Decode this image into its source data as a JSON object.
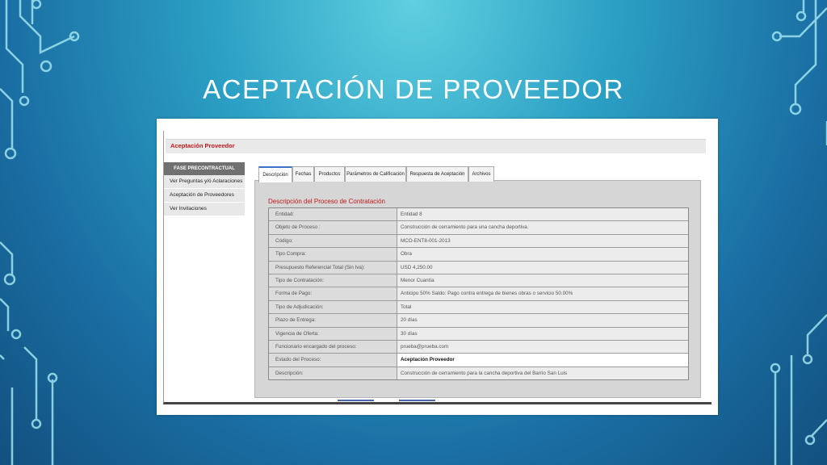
{
  "slide": {
    "title": "ACEPTACIÓN DE PROVEEDOR"
  },
  "app": {
    "header": "Aceptación Proveedor"
  },
  "sidebar": {
    "heading": "FASE PRECONTRACTUAL",
    "items": [
      {
        "label": "Ver Preguntas y/ó Aclaraciones"
      },
      {
        "label": "Aceptación de Proveedores"
      },
      {
        "label": "Ver Invitaciones"
      }
    ]
  },
  "tabs": [
    {
      "label": "Descripción"
    },
    {
      "label": "Fechas"
    },
    {
      "label": "Productos"
    },
    {
      "label": "Parámetros de Calificación"
    },
    {
      "label": "Respuesta de Aceptación"
    },
    {
      "label": "Archivos"
    }
  ],
  "section": {
    "title": "Descripción del Proceso de Contratación"
  },
  "details": [
    {
      "label": "Entidad:",
      "value": "Entidad 8"
    },
    {
      "label": "Objeto de Proceso :",
      "value": "Construcción de cerramiento para una cancha deportiva."
    },
    {
      "label": "Código:",
      "value": "MCO-ENT8-001-2013"
    },
    {
      "label": "Tipo Compra:",
      "value": "Obra"
    },
    {
      "label": "Presupuesto Referencial Total (Sin Iva):",
      "value": "USD 4,250.00"
    },
    {
      "label": "Tipo de Contratación:",
      "value": "Menor Cuantía"
    },
    {
      "label": "Forma de Pago:",
      "value": "Anticipo 50% Saldo: Pago contra entrega de bienes obras o servicio 50.00%"
    },
    {
      "label": "Tipo de Adjudicación:",
      "value": "Total"
    },
    {
      "label": "Plazo de Entrega:",
      "value": "20 días"
    },
    {
      "label": "Vigencia de Oferta:",
      "value": "30 días"
    },
    {
      "label": "Funcionario encargado del proceso:",
      "value": "prueba@prueba.com"
    },
    {
      "label": "Estado del Proceso:",
      "value": "Aceptación Proveedor",
      "strong": true
    },
    {
      "label": "Descripción:",
      "value": "Construcción de cerramiento para la cancha deportiva del Barrio San Luis"
    }
  ],
  "colors": {
    "accent_red": "#c0191b",
    "tab_active": "#3a73c6",
    "sidebar_head": "#707070"
  }
}
